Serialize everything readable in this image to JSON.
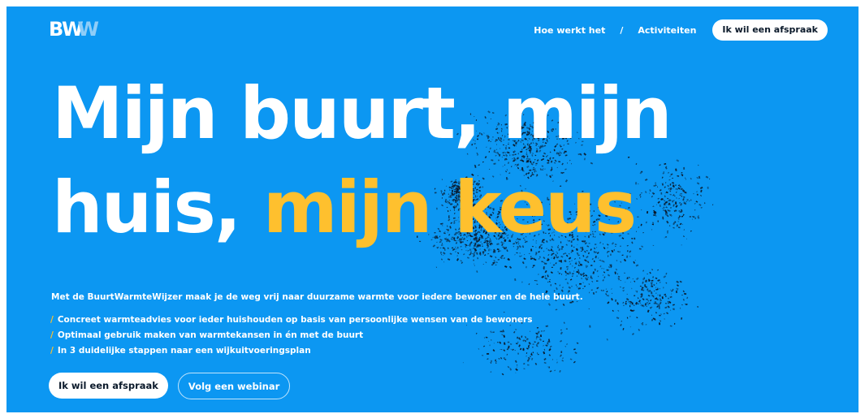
{
  "brand": {
    "logo_main": "BW",
    "logo_accent": "W"
  },
  "nav": {
    "links": [
      {
        "label": "Hoe werkt het"
      },
      {
        "label": "Activiteiten"
      }
    ],
    "separator": "/",
    "cta_label": "Ik wil een afspraak"
  },
  "hero": {
    "headline_line1": "Mijn buurt, mijn",
    "headline_line2_white": "huis, ",
    "headline_line2_highlight": "mijn keus",
    "intro": "Met de BuurtWarmteWijzer maak je de weg vrij naar duurzame warmte voor iedere bewoner en de hele buurt.",
    "bullet_marker": "/",
    "bullets": [
      "Concreet warmteadvies voor ieder huishouden op basis van persoonlijke wensen van de bewoners",
      "Optimaal gebruik maken van warmtekansen in én met de buurt",
      "In 3 duidelijke stappen naar een wijkuitvoeringsplan"
    ],
    "primary_button": "Ik wil een afspraak",
    "secondary_button": "Volg een webinar"
  },
  "colors": {
    "background": "#0c97f2",
    "highlight": "#fec02e",
    "text": "#ffffff",
    "particles": "#0a1626"
  }
}
